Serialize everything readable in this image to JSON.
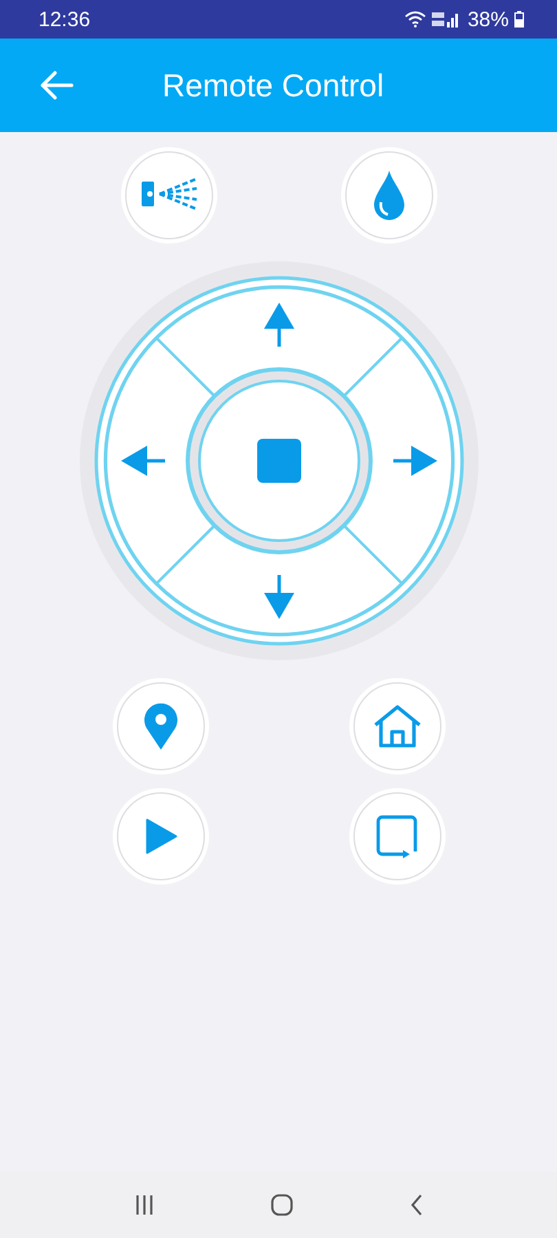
{
  "status_bar": {
    "time": "12:36",
    "battery": "38%"
  },
  "app_bar": {
    "title": "Remote Control"
  }
}
